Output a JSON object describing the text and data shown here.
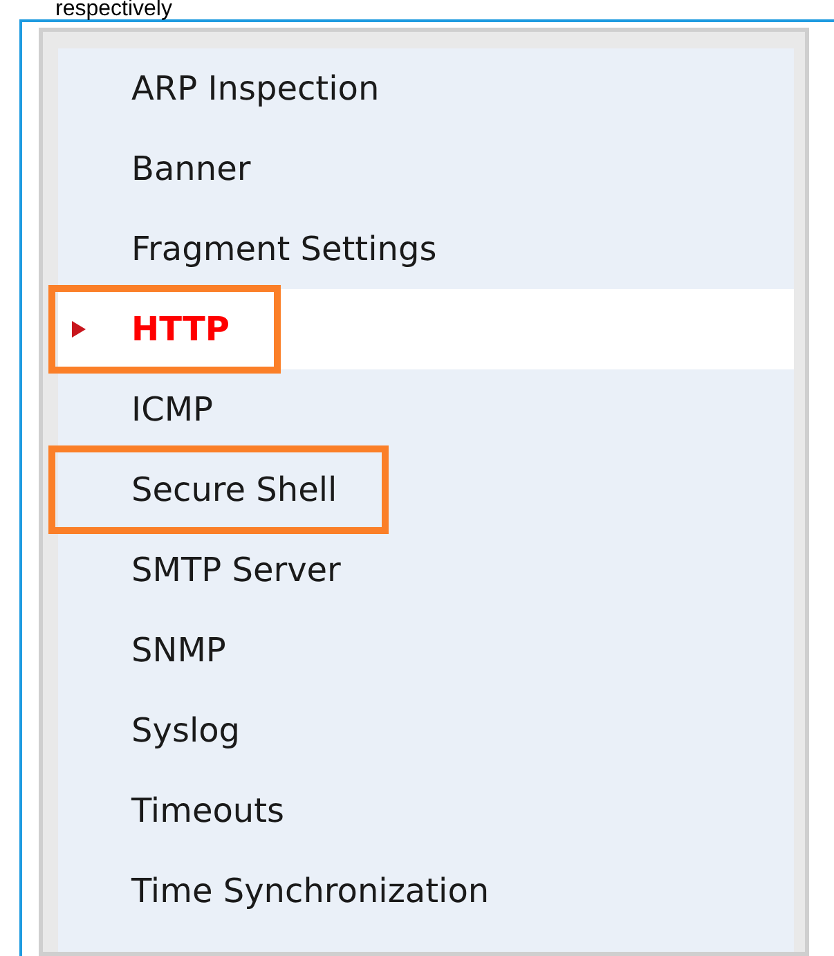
{
  "caption": "respectively",
  "items": [
    {
      "label": "ARP Inspection",
      "selected": false,
      "highlighted": false
    },
    {
      "label": "Banner",
      "selected": false,
      "highlighted": false
    },
    {
      "label": "Fragment Settings",
      "selected": false,
      "highlighted": false
    },
    {
      "label": "HTTP",
      "selected": true,
      "highlighted": true
    },
    {
      "label": "ICMP",
      "selected": false,
      "highlighted": false
    },
    {
      "label": "Secure Shell",
      "selected": false,
      "highlighted": true
    },
    {
      "label": "SMTP Server",
      "selected": false,
      "highlighted": false
    },
    {
      "label": "SNMP",
      "selected": false,
      "highlighted": false
    },
    {
      "label": "Syslog",
      "selected": false,
      "highlighted": false
    },
    {
      "label": "Timeouts",
      "selected": false,
      "highlighted": false
    },
    {
      "label": "Time Synchronization",
      "selected": false,
      "highlighted": false
    }
  ]
}
